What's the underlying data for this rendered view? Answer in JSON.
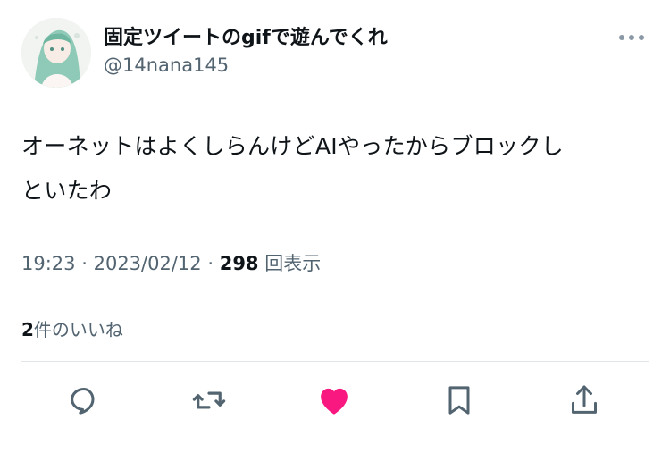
{
  "tweet": {
    "author": {
      "display_name": "固定ツイートのgifで遊んでくれ",
      "handle": "@14nana145",
      "avatar_icon": "user-avatar"
    },
    "more_icon": "more-horizontal-icon",
    "text_line1": "オーネットはよくしらんけどAIやったからブロックし",
    "text_line2": "といたわ",
    "time": "19:23",
    "separator": "·",
    "date": "2023/02/12",
    "views_count": "298",
    "views_label": "回表示",
    "likes_count": "2",
    "likes_label": "件のいいね"
  },
  "actions": [
    {
      "name": "reply",
      "icon": "reply-icon"
    },
    {
      "name": "retweet",
      "icon": "retweet-icon"
    },
    {
      "name": "like",
      "icon": "heart-icon",
      "active": true
    },
    {
      "name": "bookmark",
      "icon": "bookmark-icon"
    },
    {
      "name": "share",
      "icon": "share-icon"
    }
  ],
  "colors": {
    "text_primary": "#0f1419",
    "text_secondary": "#536471",
    "icon_default": "#536471",
    "like_active": "#f91880",
    "divider": "#e3e6e8"
  }
}
